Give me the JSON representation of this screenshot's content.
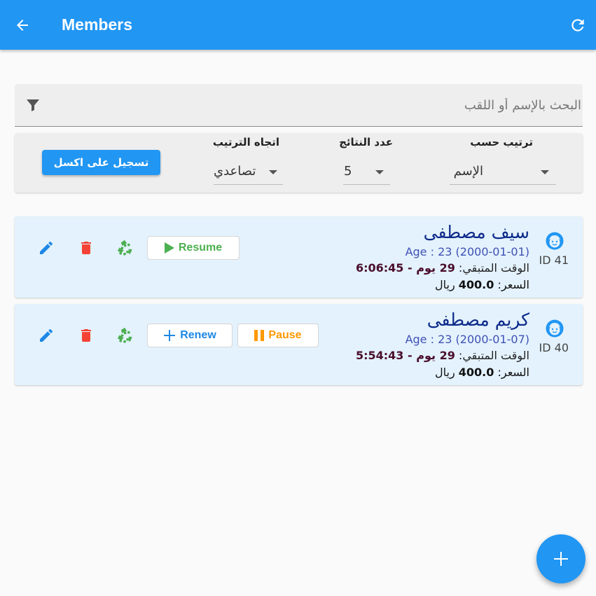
{
  "appbar": {
    "title": "Members",
    "back_icon": "arrow-left-icon",
    "refresh_icon": "refresh-icon",
    "color": "#2196f3"
  },
  "search": {
    "placeholder": "البحث بالإسم أو اللقب",
    "value": "",
    "icon": "filter-icon"
  },
  "controls": {
    "sort_by": {
      "label": "ترتيب حسب",
      "value": "الإسم"
    },
    "results_count": {
      "label": "عدد النتائج",
      "value": "5"
    },
    "sort_direction": {
      "label": "اتجاه الترتيب",
      "value": "تصاعدي"
    },
    "excel_button": "تسجيل على اكسل"
  },
  "members": [
    {
      "name": "سيف مصطفى",
      "age": "Age : 23 (2000-01-01)",
      "remaining_label": "الوقت المتبقي:",
      "remaining_value": "29 يوم - 6:06:45",
      "price_label": "السعر:",
      "price_value": "400.0",
      "currency": "ريال",
      "id_text": "ID 41",
      "resume_label": "Resume"
    },
    {
      "name": "كريم مصطفى",
      "age": "Age : 23 (2000-01-07)",
      "remaining_label": "الوقت المتبقي:",
      "remaining_value": "29 يوم - 5:54:43",
      "price_label": "السعر:",
      "price_value": "400.0",
      "currency": "ريال",
      "id_text": "ID 40",
      "renew_label": "Renew",
      "pause_label": "Pause"
    }
  ],
  "colors": {
    "primary": "#2196f3",
    "card_bg": "#e3f2fd",
    "delete": "#f44336",
    "recycle": "#4caf50",
    "resume": "#4caf50",
    "pause": "#ff9800"
  },
  "fab_icon": "plus-icon"
}
